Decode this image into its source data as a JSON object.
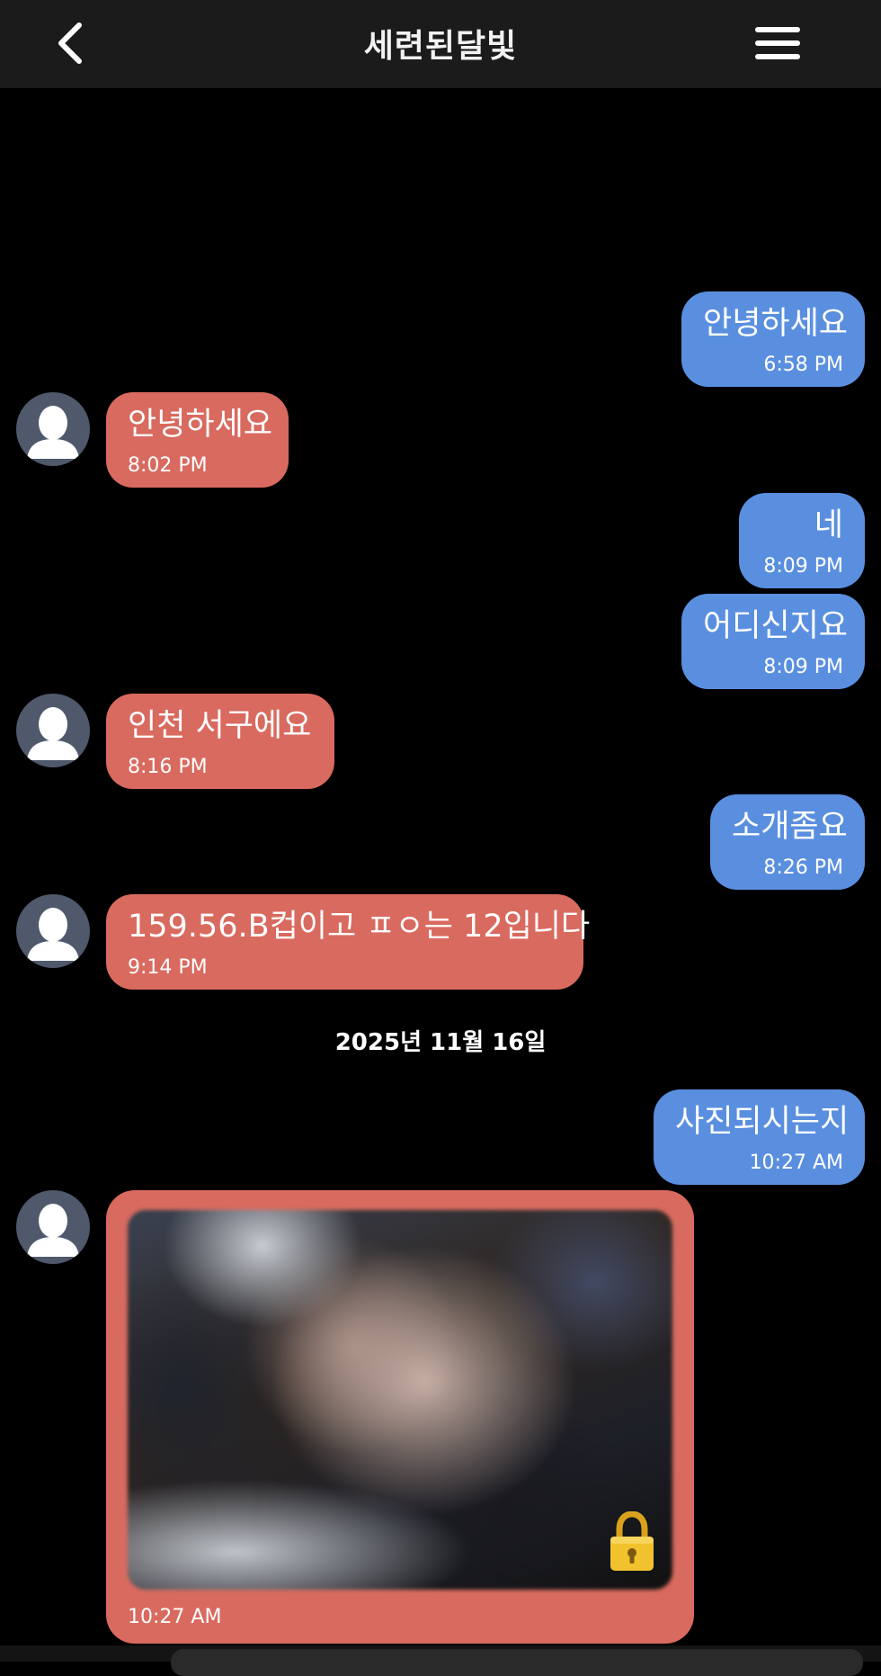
{
  "header": {
    "title": "세련된달빛",
    "back_icon": "chevron-left-icon",
    "menu_icon": "hamburger-menu-icon"
  },
  "colors": {
    "sent_bubble": "#5a8fe0",
    "received_bubble": "#d96a5f",
    "avatar_bg": "#4f596b",
    "lock": "#e8b923"
  },
  "messages": [
    {
      "sender": "me",
      "text": "안녕하세요",
      "time": "6:58 PM"
    },
    {
      "sender": "them",
      "text": "안녕하세요",
      "time": "8:02 PM"
    },
    {
      "sender": "me",
      "text": "네",
      "time": "8:09 PM"
    },
    {
      "sender": "me",
      "text": "어디신지요",
      "time": "8:09 PM"
    },
    {
      "sender": "them",
      "text": "인천 서구에요",
      "time": "8:16 PM"
    },
    {
      "sender": "me",
      "text": "소개좀요",
      "time": "8:26 PM"
    },
    {
      "sender": "them",
      "text": "159.56.B컵이고 ㅍㅇ는 12입니다",
      "time": "9:14 PM"
    },
    {
      "sender": "me",
      "text": "사진되시는지",
      "time": "10:27 AM"
    },
    {
      "sender": "them",
      "type": "locked-photo",
      "time": "10:27 AM",
      "icon": "lock-icon"
    }
  ],
  "date_separator": "2025년 11월 16일"
}
